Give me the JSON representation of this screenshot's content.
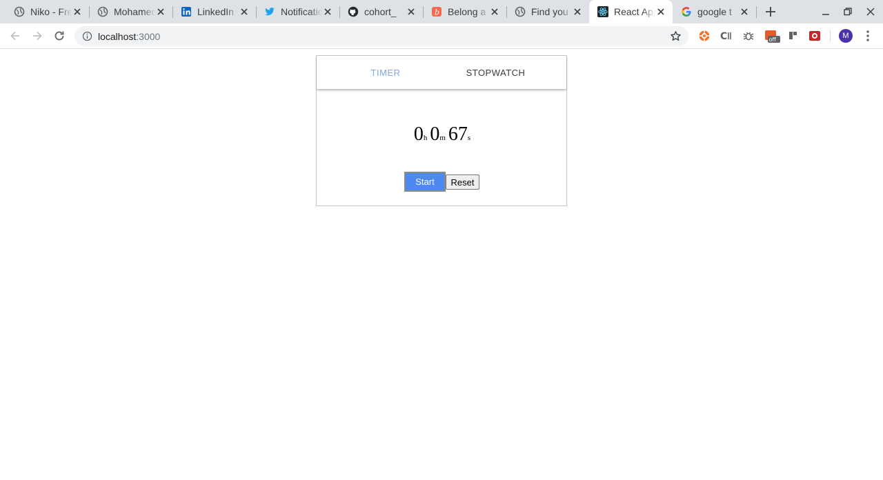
{
  "browser": {
    "tabs": [
      {
        "title": "Niko - Freelance",
        "icon": "globe-icon"
      },
      {
        "title": "Mohamed",
        "icon": "globe-icon"
      },
      {
        "title": "LinkedIn",
        "icon": "linkedin-icon"
      },
      {
        "title": "Notifications",
        "icon": "twitter-icon"
      },
      {
        "title": "cohort_",
        "icon": "github-icon"
      },
      {
        "title": "Belong a",
        "icon": "belong-icon"
      },
      {
        "title": "Find you",
        "icon": "globe-icon"
      },
      {
        "title": "React App",
        "icon": "react-icon",
        "active": true
      },
      {
        "title": "google t",
        "icon": "google-icon"
      }
    ],
    "url_host": "localhost",
    "url_port": ":3000",
    "avatar_letter": "M",
    "extension_badge": "off"
  },
  "app": {
    "tabs": {
      "timer": "TIMER",
      "stopwatch": "STOPWATCH"
    },
    "active_tab": "timer",
    "display": {
      "hours": "0",
      "hours_unit": "h",
      "minutes": "0",
      "minutes_unit": "m",
      "seconds": "67",
      "seconds_unit": "s"
    },
    "buttons": {
      "start": "Start",
      "reset": "Reset"
    }
  },
  "colors": {
    "active_tab_text": "#7fa6df",
    "start_button_bg": "#4d89ee"
  }
}
